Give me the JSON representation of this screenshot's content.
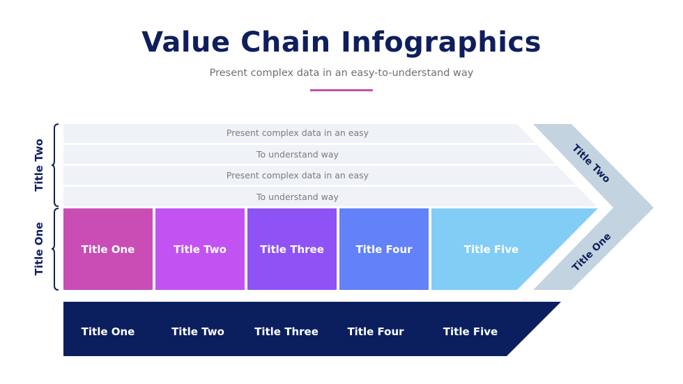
{
  "header": {
    "title": "Value Chain Infographics",
    "subtitle": "Present complex data in an easy-to-understand way"
  },
  "colors": {
    "title": "#0f1f5c",
    "accent_line": "#c34fb1",
    "stripe_bg": "#eff3f7",
    "chevron": "#c3d3df",
    "bottom_band": "#0b1f5e"
  },
  "side_labels": {
    "upper": "Title Two",
    "lower": "Title One"
  },
  "stripes": [
    "Present complex data in an easy",
    "To understand way",
    "Present complex data in an easy",
    "To understand way"
  ],
  "blocks": [
    {
      "label": "Title One",
      "color": "#c94db5"
    },
    {
      "label": "Title Two",
      "color": "#c352f3"
    },
    {
      "label": "Title Three",
      "color": "#8e52f5"
    },
    {
      "label": "Title Four",
      "color": "#6381f8"
    },
    {
      "label": "Title Five",
      "color": "#82cdf6"
    }
  ],
  "chevron": {
    "upper_label": "Title Two",
    "lower_label": "Title One"
  },
  "bottom_band": {
    "labels": [
      "Title One",
      "Title Two",
      "Title Three",
      "Title Four",
      "Title Five"
    ]
  }
}
